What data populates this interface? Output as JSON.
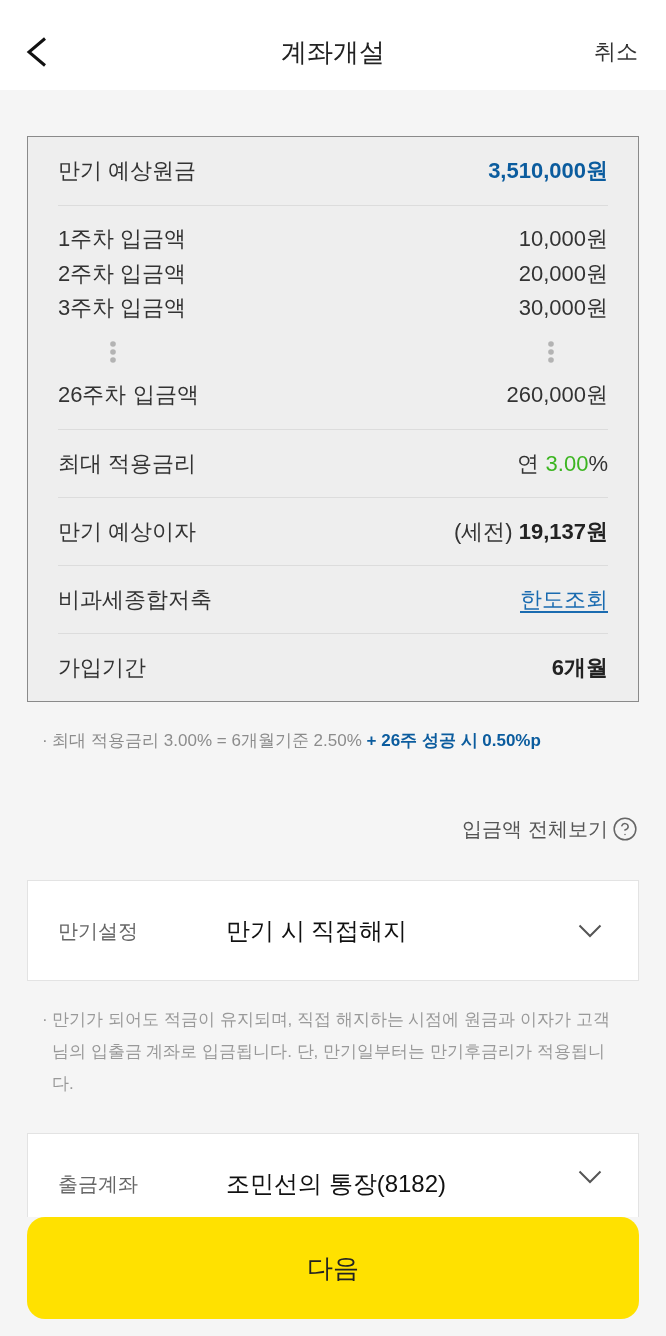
{
  "header": {
    "title": "계좌개설",
    "cancel": "취소"
  },
  "summary": {
    "rows": [
      {
        "kind": "highlight",
        "label": "만기 예상원금",
        "value": "3,510,000원"
      },
      {
        "kind": "deposits",
        "items": [
          {
            "kind": "row",
            "label": "1주차 입금액",
            "value": "10,000원"
          },
          {
            "kind": "row",
            "label": "2주차 입금액",
            "value": "20,000원"
          },
          {
            "kind": "row",
            "label": "3주차 입금액",
            "value": "30,000원"
          },
          {
            "kind": "ellipsis"
          },
          {
            "kind": "row",
            "label": "26주차 입금액",
            "value": "260,000원"
          }
        ]
      },
      {
        "kind": "rate",
        "label": "최대 적용금리",
        "prefix": "연",
        "rate": "3.00",
        "unit": "%"
      },
      {
        "kind": "rich",
        "label": "만기 예상이자",
        "value": "(세전) **19,137원**"
      },
      {
        "kind": "link",
        "label": "비과세종합저축",
        "value": "한도조회"
      },
      {
        "kind": "bold",
        "label": "가입기간",
        "value": "6개월"
      }
    ]
  },
  "rate_note": {
    "text": "· 최대 적용금리 3.00% = 6개월기준 2.50%",
    "highlight": "+ 26주 성공 시 0.50%p"
  },
  "deposit_schedule_link": "입금액 전체보기",
  "maturity": {
    "label": "만기설정",
    "value": "만기 시 직접해지",
    "note": "· 만기가 되어도 적금이 유지되며, 직접 해지하는 시점에 원금과 이자가 고객님의 입출금 계좌로 입금됩니다. 단, 만기일부터는 만기후금리가 적용됩니다."
  },
  "withdrawal_account": {
    "label": "출금계좌",
    "value": "조민선의 통장(8182)"
  },
  "next_button": "다음"
}
